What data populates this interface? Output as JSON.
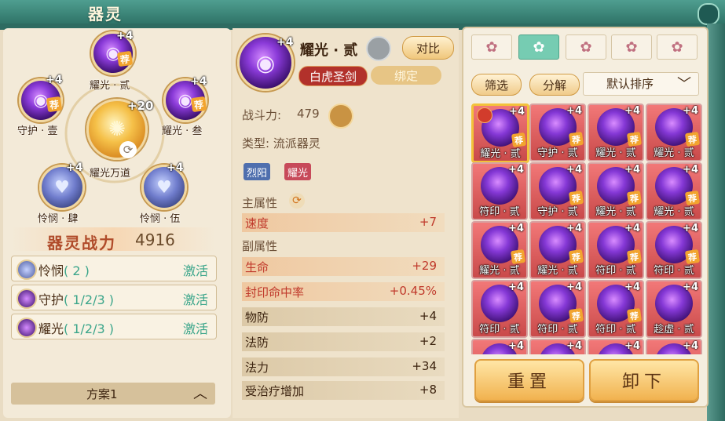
{
  "window": {
    "title": "器灵"
  },
  "wheel": {
    "center": {
      "plus": "+20",
      "label": "耀光万道"
    },
    "slots": [
      {
        "id": "top",
        "plus": "+4",
        "label": "耀光 · 贰",
        "tui": "荐",
        "kind": "orb"
      },
      {
        "id": "left",
        "plus": "+4",
        "label": "守护 · 壹",
        "tui": "荐",
        "kind": "orb"
      },
      {
        "id": "right",
        "plus": "+4",
        "label": "耀光 · 叁",
        "tui": "荐",
        "kind": "orb"
      },
      {
        "id": "bottom-left",
        "plus": "+4",
        "label": "怜悯 · 肆",
        "kind": "heart"
      },
      {
        "id": "bottom-right",
        "plus": "+4",
        "label": "怜悯 · 伍",
        "kind": "heart"
      }
    ]
  },
  "power": {
    "label": "器灵战力",
    "value": "4916"
  },
  "sets": [
    {
      "name": "怜悯",
      "count": "( 2 )",
      "action": "激活"
    },
    {
      "name": "守护",
      "count": "( 1/2/3 )",
      "action": "激活"
    },
    {
      "name": "耀光",
      "count": "( 1/2/3 )",
      "action": "激活"
    }
  ],
  "scheme": {
    "label": "方案1"
  },
  "detail": {
    "plus": "+4",
    "name": "耀光 · 贰",
    "compare": "对比",
    "tag_red": "白虎圣剑",
    "tag_gold": "绑定",
    "combat_label": "战斗力:",
    "combat_value": "479",
    "type_text": "类型: 流派器灵",
    "chips": [
      {
        "text": "烈阳",
        "color": "#4f6fae"
      },
      {
        "text": "耀光",
        "color": "#c74a5a"
      }
    ],
    "main_attr_label": "主属性",
    "main_attrs": [
      {
        "k": "速度",
        "v": "+7",
        "hl": true
      }
    ],
    "sub_attr_label": "副属性",
    "sub_attrs": [
      {
        "k": "生命",
        "v": "+29",
        "hl": true
      },
      {
        "k": "封印命中率",
        "v": "+0.45%",
        "hl": true
      },
      {
        "k": "物防",
        "v": "+4",
        "hl": false
      },
      {
        "k": "法防",
        "v": "+2",
        "hl": false
      },
      {
        "k": "法力",
        "v": "+34",
        "hl": false
      },
      {
        "k": "受治疗增加",
        "v": "+8",
        "hl": false
      }
    ]
  },
  "right": {
    "tabs": [
      "✿",
      "✿",
      "✿",
      "✿",
      "✿"
    ],
    "active_tab": 1,
    "filter": "筛选",
    "decompose": "分解",
    "sort": "默认排序",
    "grid": [
      {
        "name": "耀光 · 贰",
        "plus": "+4",
        "tui": true,
        "sel": true
      },
      {
        "name": "守护 · 贰",
        "plus": "+4",
        "tui": true
      },
      {
        "name": "耀光 · 贰",
        "plus": "+4",
        "tui": true
      },
      {
        "name": "耀光 · 贰",
        "plus": "+4",
        "tui": true
      },
      {
        "name": "符印 · 贰",
        "plus": "+4",
        "tui": false
      },
      {
        "name": "守护 · 贰",
        "plus": "+4",
        "tui": true
      },
      {
        "name": "耀光 · 贰",
        "plus": "+4",
        "tui": true
      },
      {
        "name": "耀光 · 贰",
        "plus": "+4",
        "tui": true
      },
      {
        "name": "耀光 · 贰",
        "plus": "+4",
        "tui": true
      },
      {
        "name": "耀光 · 贰",
        "plus": "+4",
        "tui": true
      },
      {
        "name": "符印 · 贰",
        "plus": "+4",
        "tui": true
      },
      {
        "name": "符印 · 贰",
        "plus": "+4",
        "tui": true
      },
      {
        "name": "符印 · 贰",
        "plus": "+4",
        "tui": false
      },
      {
        "name": "符印 · 贰",
        "plus": "+4",
        "tui": true
      },
      {
        "name": "符印 · 贰",
        "plus": "+4",
        "tui": true
      },
      {
        "name": "趁虚 · 贰",
        "plus": "+4",
        "tui": false
      },
      {
        "name": "",
        "plus": "+4",
        "tui": false
      },
      {
        "name": "",
        "plus": "+4",
        "tui": false
      },
      {
        "name": "",
        "plus": "+4",
        "tui": false
      },
      {
        "name": "",
        "plus": "+4",
        "tui": false
      }
    ],
    "reset": "重置",
    "unload": "卸下"
  }
}
